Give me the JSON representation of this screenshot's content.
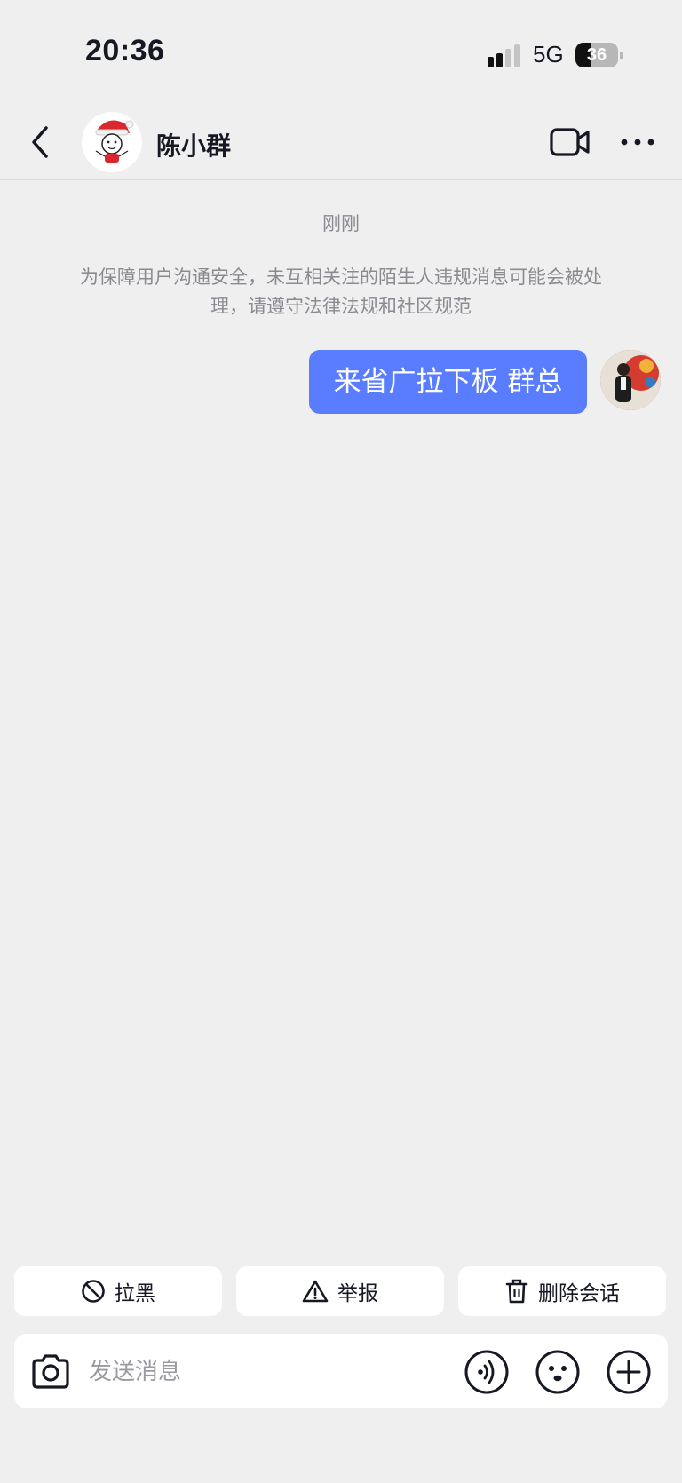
{
  "status_bar": {
    "time": "20:36",
    "network": "5G",
    "battery": "36",
    "battery_level": 0.36
  },
  "header": {
    "contact_name": "陈小群",
    "icons": [
      "back-chevron-icon",
      "video-call-icon",
      "more-dots-icon"
    ]
  },
  "chat": {
    "timestamp": "刚刚",
    "notice": "为保障用户沟通安全，未互相关注的陌生人违规消息可能会被处理，请遵守法律法规和社区规范",
    "messages": [
      {
        "from": "me",
        "text": "来省广拉下板 群总"
      }
    ]
  },
  "actions": {
    "block_label": "拉黑",
    "report_label": "举报",
    "delete_label": "删除会话"
  },
  "input": {
    "placeholder": "发送消息"
  },
  "colors": {
    "background": "#efefef",
    "bubble": "#5a7dff",
    "text": "#161823",
    "muted": "#8a8b91"
  }
}
